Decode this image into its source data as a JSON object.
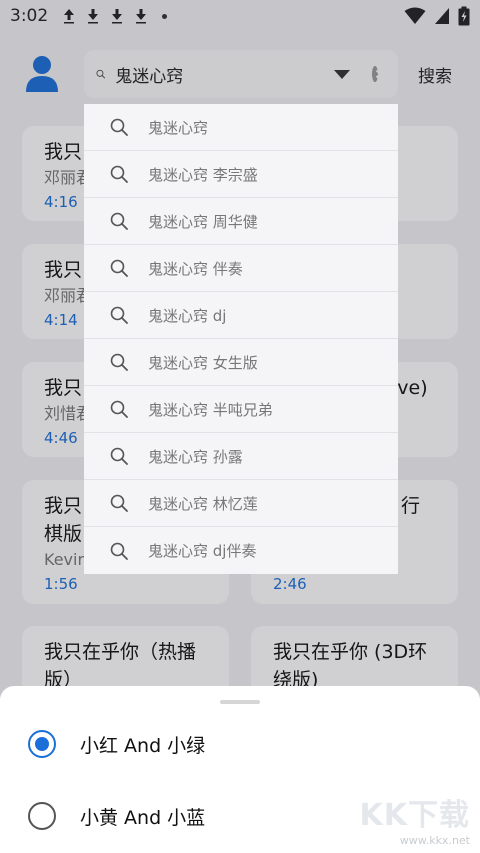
{
  "status_bar": {
    "time": "3:02"
  },
  "search": {
    "query": "鬼迷心窍",
    "button_label": "搜索"
  },
  "suggestions": [
    "鬼迷心窍",
    "鬼迷心窍 李宗盛",
    "鬼迷心窍 周华健",
    "鬼迷心窍 伴奏",
    "鬼迷心窍 dj",
    "鬼迷心窍 女生版",
    "鬼迷心窍 半吨兄弟",
    "鬼迷心窍 孙露",
    "鬼迷心窍 林忆莲",
    "鬼迷心窍 dj伴奏"
  ],
  "results": [
    {
      "title": "我只",
      "artist": "邓丽君",
      "duration": "4:16 ·"
    },
    {
      "title": "我只",
      "artist": "邓丽君",
      "duration": "4:14 ·"
    },
    {
      "title": "我只",
      "title_right": "ive)",
      "artist": "刘惜君",
      "duration": "4:46"
    },
    {
      "title": "我只",
      "title2": "棋版",
      "artist": "Kevin",
      "duration": "1:56"
    },
    {
      "title": "行",
      "duration": "2:46"
    },
    {
      "title": "我只在乎你（热播",
      "title2": "版）"
    },
    {
      "title": "我只在乎你 (3D环",
      "title2": "绕版)"
    }
  ],
  "sheet": {
    "options": [
      {
        "label": "小红 And 小绿",
        "selected": true
      },
      {
        "label": "小黄 And 小蓝",
        "selected": false
      }
    ]
  },
  "watermark": {
    "big": "KK下载",
    "small": "www.kkx.net"
  },
  "colors": {
    "accent": "#1a6fd9",
    "background": "#f3f3f5"
  }
}
